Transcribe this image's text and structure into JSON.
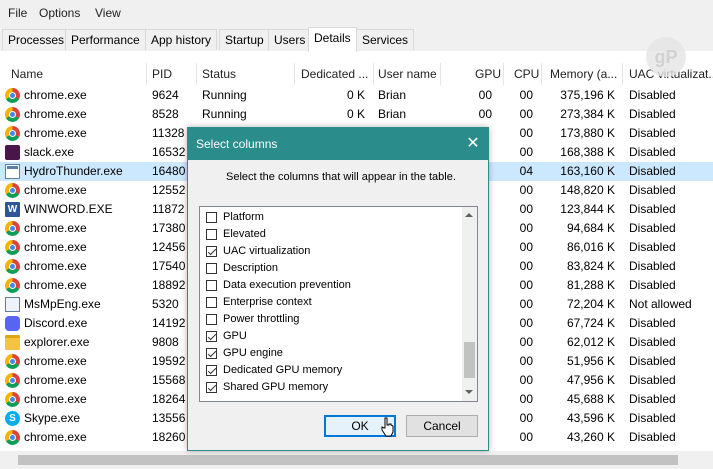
{
  "menu": [
    "File",
    "Options",
    "View"
  ],
  "tabs": [
    "Processes",
    "Performance",
    "App history",
    "Startup",
    "Users",
    "Details",
    "Services"
  ],
  "active_tab": "Details",
  "columns": [
    "Name",
    "PID",
    "Status",
    "Dedicated ...",
    "User name",
    "GPU",
    "CPU",
    "Memory (a...",
    "UAC virtualizat..."
  ],
  "rows": [
    {
      "icon": "chrome-icon",
      "name": "chrome.exe",
      "pid": "9624",
      "status": "Running",
      "dedicated": "0 K",
      "user": "Brian",
      "gpu": "00",
      "cpu": "00",
      "memory": "375,196 K",
      "uac": "Disabled"
    },
    {
      "icon": "chrome-icon",
      "name": "chrome.exe",
      "pid": "8528",
      "status": "Running",
      "dedicated": "0 K",
      "user": "Brian",
      "gpu": "00",
      "cpu": "00",
      "memory": "273,384 K",
      "uac": "Disabled"
    },
    {
      "icon": "chrome-icon",
      "name": "chrome.exe",
      "pid": "11328",
      "status": "",
      "dedicated": "",
      "user": "",
      "gpu": "",
      "cpu": "00",
      "memory": "173,880 K",
      "uac": "Disabled"
    },
    {
      "icon": "slack-icon",
      "name": "slack.exe",
      "pid": "16532",
      "status": "",
      "dedicated": "",
      "user": "",
      "gpu": "",
      "cpu": "00",
      "memory": "168,388 K",
      "uac": "Disabled"
    },
    {
      "icon": "app-window-icon",
      "name": "HydroThunder.exe",
      "pid": "16480",
      "status": "",
      "dedicated": "",
      "user": "",
      "gpu": "",
      "cpu": "04",
      "memory": "163,160 K",
      "uac": "Disabled",
      "selected": true
    },
    {
      "icon": "chrome-icon",
      "name": "chrome.exe",
      "pid": "12552",
      "status": "",
      "dedicated": "",
      "user": "",
      "gpu": "",
      "cpu": "00",
      "memory": "148,820 K",
      "uac": "Disabled"
    },
    {
      "icon": "word-icon",
      "name": "WINWORD.EXE",
      "pid": "11872",
      "status": "",
      "dedicated": "",
      "user": "",
      "gpu": "",
      "cpu": "00",
      "memory": "123,844 K",
      "uac": "Disabled"
    },
    {
      "icon": "chrome-icon",
      "name": "chrome.exe",
      "pid": "17380",
      "status": "",
      "dedicated": "",
      "user": "",
      "gpu": "",
      "cpu": "00",
      "memory": "94,684 K",
      "uac": "Disabled"
    },
    {
      "icon": "chrome-icon",
      "name": "chrome.exe",
      "pid": "12456",
      "status": "",
      "dedicated": "",
      "user": "",
      "gpu": "",
      "cpu": "00",
      "memory": "86,016 K",
      "uac": "Disabled"
    },
    {
      "icon": "chrome-icon",
      "name": "chrome.exe",
      "pid": "17540",
      "status": "",
      "dedicated": "",
      "user": "",
      "gpu": "",
      "cpu": "00",
      "memory": "83,824 K",
      "uac": "Disabled"
    },
    {
      "icon": "chrome-icon",
      "name": "chrome.exe",
      "pid": "18892",
      "status": "",
      "dedicated": "",
      "user": "",
      "gpu": "",
      "cpu": "00",
      "memory": "81,288 K",
      "uac": "Disabled"
    },
    {
      "icon": "msmpeng-icon",
      "name": "MsMpEng.exe",
      "pid": "5320",
      "status": "",
      "dedicated": "",
      "user": "",
      "gpu": "",
      "cpu": "00",
      "memory": "72,204 K",
      "uac": "Not allowed"
    },
    {
      "icon": "discord-icon",
      "name": "Discord.exe",
      "pid": "14192",
      "status": "",
      "dedicated": "",
      "user": "",
      "gpu": "",
      "cpu": "00",
      "memory": "67,724 K",
      "uac": "Disabled"
    },
    {
      "icon": "explorer-icon",
      "name": "explorer.exe",
      "pid": "9808",
      "status": "",
      "dedicated": "",
      "user": "",
      "gpu": "",
      "cpu": "00",
      "memory": "62,012 K",
      "uac": "Disabled"
    },
    {
      "icon": "chrome-icon",
      "name": "chrome.exe",
      "pid": "19592",
      "status": "",
      "dedicated": "",
      "user": "",
      "gpu": "",
      "cpu": "00",
      "memory": "51,956 K",
      "uac": "Disabled"
    },
    {
      "icon": "chrome-icon",
      "name": "chrome.exe",
      "pid": "15568",
      "status": "",
      "dedicated": "",
      "user": "",
      "gpu": "",
      "cpu": "00",
      "memory": "47,956 K",
      "uac": "Disabled"
    },
    {
      "icon": "chrome-icon",
      "name": "chrome.exe",
      "pid": "18264",
      "status": "",
      "dedicated": "",
      "user": "",
      "gpu": "",
      "cpu": "00",
      "memory": "45,688 K",
      "uac": "Disabled"
    },
    {
      "icon": "skype-icon",
      "name": "Skype.exe",
      "pid": "13556",
      "status": "",
      "dedicated": "",
      "user": "",
      "gpu": "",
      "cpu": "00",
      "memory": "43,596 K",
      "uac": "Disabled"
    },
    {
      "icon": "chrome-icon",
      "name": "chrome.exe",
      "pid": "18260",
      "status": "",
      "dedicated": "",
      "user": "",
      "gpu": "",
      "cpu": "00",
      "memory": "43,260 K",
      "uac": "Disabled"
    }
  ],
  "dialog": {
    "title": "Select columns",
    "description": "Select the columns that will appear in the table.",
    "options": [
      {
        "label": "Platform",
        "checked": false
      },
      {
        "label": "Elevated",
        "checked": false
      },
      {
        "label": "UAC virtualization",
        "checked": true
      },
      {
        "label": "Description",
        "checked": false
      },
      {
        "label": "Data execution prevention",
        "checked": false
      },
      {
        "label": "Enterprise context",
        "checked": false
      },
      {
        "label": "Power throttling",
        "checked": false
      },
      {
        "label": "GPU",
        "checked": true
      },
      {
        "label": "GPU engine",
        "checked": true
      },
      {
        "label": "Dedicated GPU memory",
        "checked": true
      },
      {
        "label": "Shared GPU memory",
        "checked": true
      }
    ],
    "ok_label": "OK",
    "cancel_label": "Cancel"
  },
  "colors": {
    "accent": "#2b8c8c",
    "selection": "#cce8ff",
    "focus": "#0078d7"
  }
}
